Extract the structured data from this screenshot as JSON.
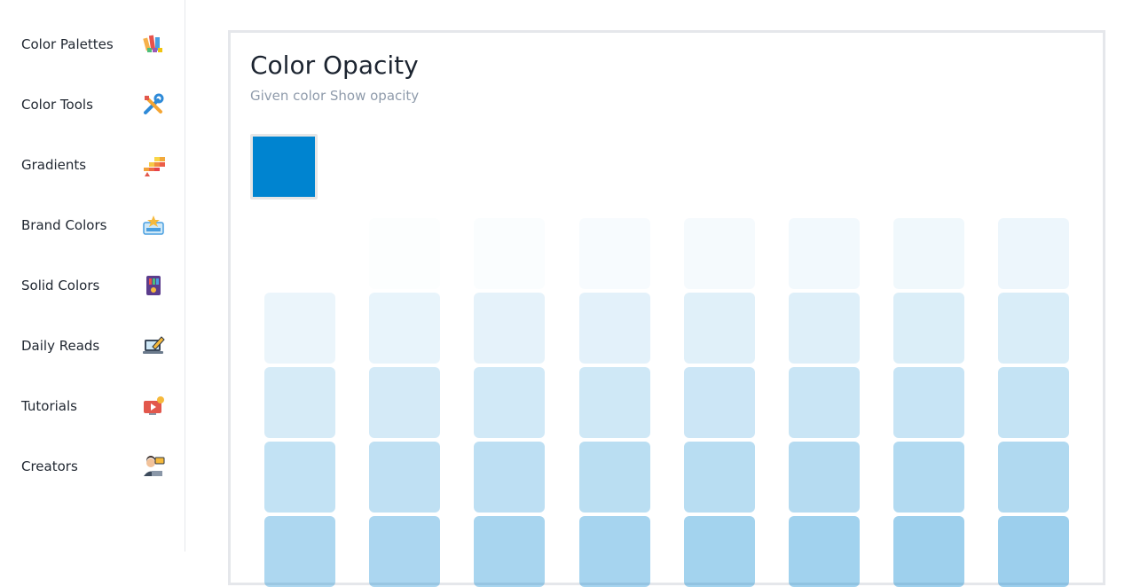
{
  "sidebar": {
    "items": [
      {
        "label": "Color Palettes",
        "icon": "palette-icon"
      },
      {
        "label": "Color Tools",
        "icon": "tools-icon"
      },
      {
        "label": "Gradients",
        "icon": "gradient-icon"
      },
      {
        "label": "Brand Colors",
        "icon": "brand-icon"
      },
      {
        "label": "Solid Colors",
        "icon": "solid-colors-icon"
      },
      {
        "label": "Daily Reads",
        "icon": "laptop-edit-icon"
      },
      {
        "label": "Tutorials",
        "icon": "video-icon"
      },
      {
        "label": "Creators",
        "icon": "creator-icon"
      }
    ]
  },
  "main": {
    "title": "Color Opacity",
    "subtitle": "Given color Show opacity",
    "base_color": "#0084d0",
    "opacity_steps": [
      0,
      0.01,
      0.02,
      0.03,
      0.04,
      0.05,
      0.06,
      0.07,
      0.08,
      0.09,
      0.1,
      0.11,
      0.12,
      0.13,
      0.14,
      0.15,
      0.16,
      0.17,
      0.18,
      0.19,
      0.2,
      0.21,
      0.22,
      0.23,
      0.24,
      0.25,
      0.26,
      0.27,
      0.28,
      0.29,
      0.3,
      0.31,
      0.32,
      0.33,
      0.34,
      0.35,
      0.36,
      0.37,
      0.38,
      0.39
    ]
  }
}
